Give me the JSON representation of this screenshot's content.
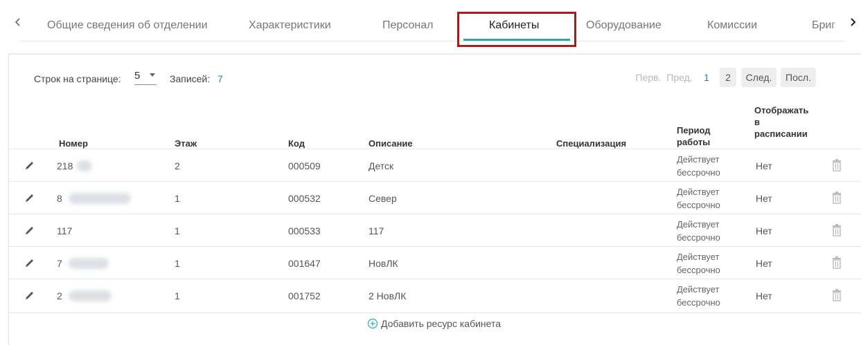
{
  "tabs": {
    "items": [
      {
        "label": "Общие сведения об отделении"
      },
      {
        "label": "Характеристики"
      },
      {
        "label": "Персонал"
      },
      {
        "label": "Кабинеты"
      },
      {
        "label": "Оборудование"
      },
      {
        "label": "Комиссии"
      },
      {
        "label": "Бриг"
      }
    ],
    "active": "Кабинеты",
    "accent_color": "#2aa7b3",
    "highlight_color": "#a51d1d"
  },
  "toolbar": {
    "rows_label": "Строк на странице:",
    "rows_value": "5",
    "records_label": "Записей:",
    "records_value": "7"
  },
  "pagination": {
    "first": "Перв.",
    "prev": "Пред.",
    "pages": [
      "1",
      "2"
    ],
    "next": "След.",
    "last": "Посл."
  },
  "table": {
    "headers": {
      "number": "Номер",
      "floor": "Этаж",
      "code": "Код",
      "description": "Описание",
      "specialization": "Специализация",
      "period": [
        "Период",
        "работы"
      ],
      "show": [
        "Отображать",
        "в",
        "расписании"
      ]
    },
    "rows": [
      {
        "number": "218",
        "floor": "2",
        "code": "000509",
        "description": "Детск",
        "specialization": "",
        "period": [
          "Действует",
          "бессрочно"
        ],
        "show": "Нет"
      },
      {
        "number": "8",
        "floor": "1",
        "code": "000532",
        "description": "Север",
        "specialization": "",
        "period": [
          "Действует",
          "бессрочно"
        ],
        "show": "Нет"
      },
      {
        "number": "117",
        "floor": "1",
        "code": "000533",
        "description": "117",
        "specialization": "",
        "period": [
          "Действует",
          "бессрочно"
        ],
        "show": "Нет"
      },
      {
        "number": "7",
        "floor": "1",
        "code": "001647",
        "description": "НовЛК",
        "specialization": "",
        "period": [
          "Действует",
          "бессрочно"
        ],
        "show": "Нет"
      },
      {
        "number": "2",
        "floor": "1",
        "code": "001752",
        "description": "2 НовЛК",
        "specialization": "",
        "period": [
          "Действует",
          "бессрочно"
        ],
        "show": "Нет"
      }
    ]
  },
  "add_button": {
    "label": "Добавить ресурс кабинета",
    "icon": "plus-circle-icon"
  }
}
